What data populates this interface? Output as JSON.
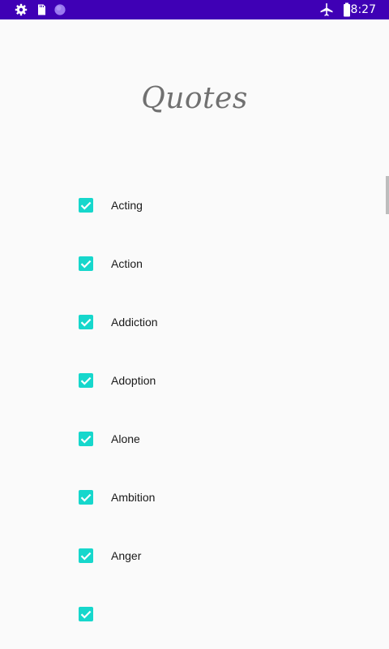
{
  "status_bar": {
    "time": "8:27",
    "left_icons": [
      "gear-icon",
      "sim-card-icon",
      "circle-icon"
    ],
    "right_icons": [
      "airplane-icon",
      "battery-icon"
    ],
    "background": "#3f00b5"
  },
  "page": {
    "title": "Quotes"
  },
  "checkbox_color": "#16d7cc",
  "categories": [
    {
      "label": "Acting",
      "checked": true
    },
    {
      "label": "Action",
      "checked": true
    },
    {
      "label": "Addiction",
      "checked": true
    },
    {
      "label": "Adoption",
      "checked": true
    },
    {
      "label": "Alone",
      "checked": true
    },
    {
      "label": "Ambition",
      "checked": true
    },
    {
      "label": "Anger",
      "checked": true
    },
    {
      "label": "",
      "checked": true
    }
  ]
}
